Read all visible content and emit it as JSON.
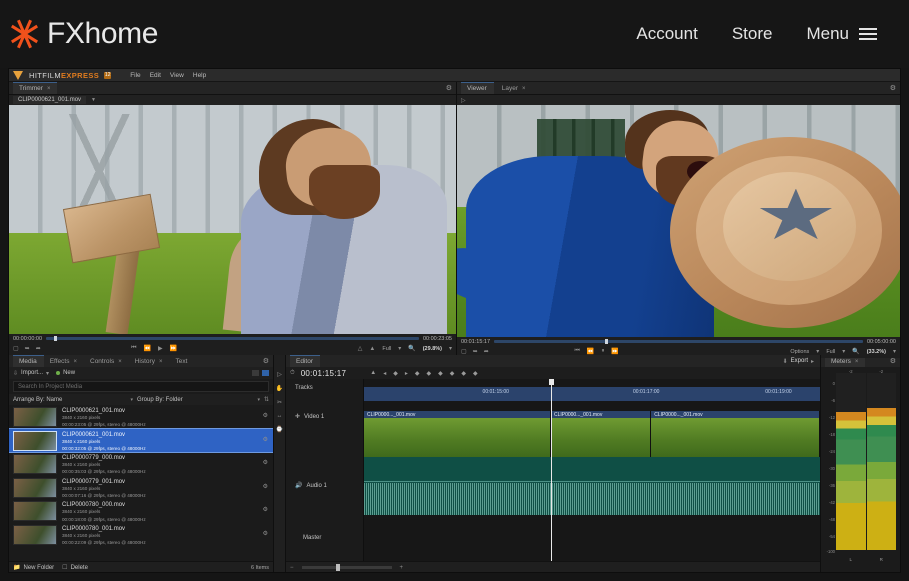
{
  "site": {
    "brand": "FXhome",
    "nav": [
      {
        "label": "Account"
      },
      {
        "label": "Store"
      },
      {
        "label": "Menu"
      }
    ]
  },
  "app": {
    "title_prefix": "HITFILM",
    "title_suffix": "EXPRESS",
    "badge": "12",
    "menus": [
      "File",
      "Edit",
      "View",
      "Help"
    ]
  },
  "trimmer": {
    "tab": "Trimmer",
    "close": "×",
    "filename": "CLIP0000621_001.mov",
    "timecode_current": "00:00:00:00",
    "timecode_total": "00:00:23:05",
    "quality": "Full",
    "zoom": "(29.8%)"
  },
  "viewer": {
    "tabs": [
      {
        "label": "Viewer",
        "active": true
      },
      {
        "label": "Layer",
        "active": false
      }
    ],
    "close": "×",
    "timecode_current": "00:01:15:17",
    "timecode_total": "00:05:00:00",
    "options": "Options",
    "quality": "Full",
    "zoom": "(33.2%)"
  },
  "media": {
    "tabs": [
      {
        "label": "Media",
        "active": true
      },
      {
        "label": "Effects",
        "active": false
      },
      {
        "label": "Controls",
        "active": false
      },
      {
        "label": "History",
        "active": false
      },
      {
        "label": "Text",
        "active": false
      }
    ],
    "import_label": "Import...",
    "new_label": "New",
    "search_placeholder": "Search In Project Media",
    "arrange_by": "Arrange By: Name",
    "group_by": "Group By: Folder",
    "items": [
      {
        "name": "CLIP0000621_001.mov",
        "res": "3840 x 2160 pixels",
        "meta": "00:00:23:05 @ 29fps, stereo @ 48000Hz",
        "selected": false
      },
      {
        "name": "CLIP0000621_001.mov",
        "res": "3840 x 2160 pixels",
        "meta": "00:00:32:05 @ 29fps, stereo @ 48000Hz",
        "selected": true
      },
      {
        "name": "CLIP0000779_000.mov",
        "res": "3840 x 2160 pixels",
        "meta": "00:00:35:03 @ 29fps, stereo @ 48000Hz",
        "selected": false
      },
      {
        "name": "CLIP0000779_001.mov",
        "res": "3840 x 2160 pixels",
        "meta": "00:00:07:16 @ 29fps, stereo @ 48000Hz",
        "selected": false
      },
      {
        "name": "CLIP0000780_000.mov",
        "res": "3840 x 2160 pixels",
        "meta": "00:00:18:00 @ 29fps, stereo @ 48000Hz",
        "selected": false
      },
      {
        "name": "CLIP0000780_001.mov",
        "res": "3840 x 2160 pixels",
        "meta": "00:00:22:09 @ 29fps, stereo @ 48000Hz",
        "selected": false
      }
    ],
    "new_folder": "New Folder",
    "delete": "Delete",
    "item_count": "6 Items"
  },
  "editor": {
    "tab": "Editor",
    "export": "Export",
    "timecode": "00:01:15:17",
    "tracks_label": "Tracks",
    "video_track": "Video 1",
    "audio_track": "Audio 1",
    "master_track": "Master",
    "strip_labels": [
      "00:01:15:00",
      "00:01:17:00",
      "00:01:19:00"
    ],
    "clips": [
      {
        "name": "CLIP0000..._001.mov"
      },
      {
        "name": "CLIP0000..._001.mov"
      },
      {
        "name": "CLIP0000..._001.mov"
      }
    ]
  },
  "meters": {
    "tab": "Meters",
    "close": "×",
    "channels": [
      "L",
      "R"
    ],
    "top_labels": [
      "-2",
      "-2"
    ],
    "scale": [
      "0",
      "-6",
      "-12",
      "-18",
      "-24",
      "-30",
      "-36",
      "-42",
      "-48",
      "-54",
      "-100"
    ],
    "levels": [
      78,
      80
    ]
  },
  "colors": {
    "accent_orange": "#f1511b",
    "hitfilm_orange": "#e07b1e",
    "selection_blue": "#2f63c4",
    "timeline_blue": "#2b436c",
    "audio_teal": "#0f4f45"
  }
}
